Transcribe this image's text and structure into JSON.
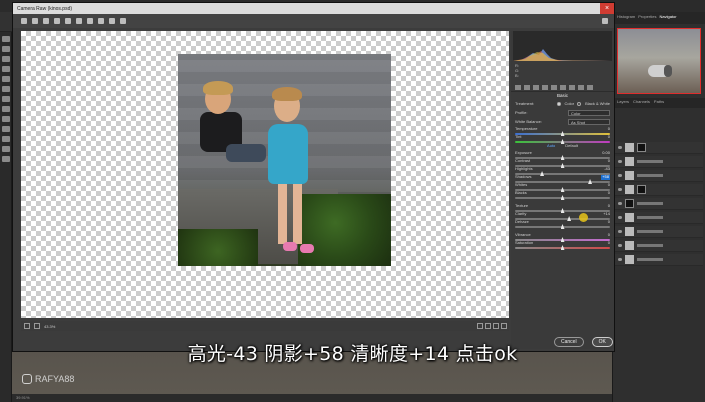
{
  "dialog": {
    "title": "Camera Raw (kinos.psd)",
    "close_label": "×"
  },
  "histogram_readout": [
    "R:",
    "G:",
    "B:"
  ],
  "panel": {
    "section_basic": "Basic",
    "treatment_label": "Treatment:",
    "treatment_color": "Color",
    "treatment_bw": "Black & White",
    "profile_label": "Profile:",
    "profile_value": "Color",
    "wb_label": "White Balance:",
    "wb_value": "As Shot",
    "auto_label": "Auto",
    "default_label": "Default",
    "sliders": [
      {
        "label": "Temperature",
        "value": "0",
        "pos": 0.5
      },
      {
        "label": "Tint",
        "value": "0",
        "pos": 0.5
      },
      {
        "label": "Exposure",
        "value": "0.00",
        "pos": 0.5
      },
      {
        "label": "Contrast",
        "value": "0",
        "pos": 0.5
      },
      {
        "label": "Highlights",
        "value": "-43",
        "pos": 0.285
      },
      {
        "label": "Shadows",
        "value": "+58",
        "pos": 0.79,
        "highlighted": true
      },
      {
        "label": "Whites",
        "value": "0",
        "pos": 0.5
      },
      {
        "label": "Blacks",
        "value": "0",
        "pos": 0.5
      },
      {
        "label": "Texture",
        "value": "0",
        "pos": 0.5
      },
      {
        "label": "Clarity",
        "value": "+14",
        "pos": 0.57
      },
      {
        "label": "Dehaze",
        "value": "0",
        "pos": 0.5
      },
      {
        "label": "Vibrance",
        "value": "0",
        "pos": 0.5
      },
      {
        "label": "Saturation",
        "value": "0",
        "pos": 0.5
      }
    ]
  },
  "zoom_label": "43.3%",
  "cancel_label": "Cancel",
  "ok_label": "OK",
  "right_panels": {
    "nav_tabs": [
      "Histogram",
      "Properties",
      "Navigator"
    ]
  },
  "watermark": "RAFYA88",
  "status_zoom": "39.91%",
  "subtitle": "高光-43 阴影+58 清晰度+14 点击ok"
}
